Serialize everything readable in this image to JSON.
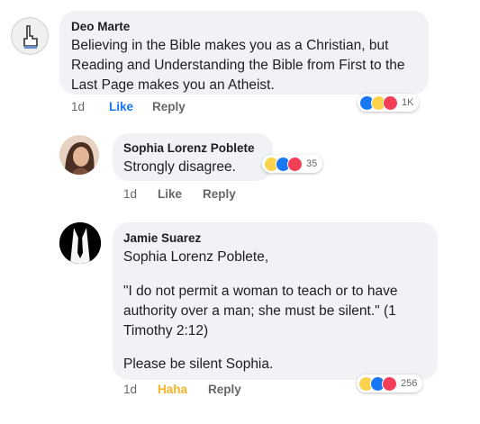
{
  "comments": [
    {
      "author": "Deo Marte",
      "text": "Believing in the Bible makes you as a Christian, but Reading and Understanding the Bible from First to the Last Page makes you an Atheist.",
      "time": "1d",
      "like_label": "Like",
      "reply_label": "Reply",
      "reactions": [
        "like",
        "haha",
        "love"
      ],
      "reaction_count": "1K"
    },
    {
      "author": "Sophia Lorenz Poblete",
      "text": "Strongly disagree.",
      "time": "1d",
      "like_label": "Like",
      "reply_label": "Reply",
      "reactions": [
        "haha",
        "like",
        "love"
      ],
      "reaction_count": "35"
    },
    {
      "author": "Jamie Suarez",
      "line1": "Sophia Lorenz Poblete,",
      "line2": "\"I do not permit a woman to teach or to have authority over a man; she must be silent.\" (1 Timothy 2:12)",
      "line3": "Please be silent Sophia.",
      "time": "1d",
      "like_label": "Haha",
      "reply_label": "Reply",
      "reactions": [
        "haha",
        "like",
        "love"
      ],
      "reaction_count": "256"
    }
  ],
  "colors": {
    "bubble": "#f0f2f5",
    "like_blue": "#1877f2",
    "haha_yellow": "#f7b125",
    "love_red": "#f33e58"
  }
}
